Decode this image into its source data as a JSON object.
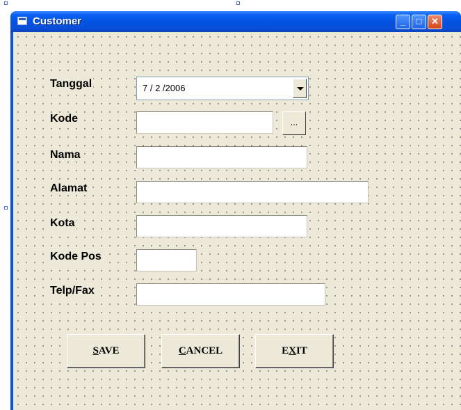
{
  "window": {
    "title": "Customer",
    "minimize_glyph": "_",
    "maximize_glyph": "□",
    "close_glyph": "✕"
  },
  "form": {
    "tanggal": {
      "label": "Tanggal",
      "value": "7 / 2 /2006"
    },
    "kode": {
      "label": "Kode",
      "value": "",
      "browse_label": "..."
    },
    "nama": {
      "label": "Nama",
      "value": ""
    },
    "alamat": {
      "label": "Alamat",
      "value": ""
    },
    "kota": {
      "label": "Kota",
      "value": ""
    },
    "kode_pos": {
      "label": "Kode Pos",
      "value": ""
    },
    "telp_fax": {
      "label": "Telp/Fax",
      "value": ""
    }
  },
  "buttons": {
    "save": {
      "accel": "S",
      "rest": "AVE"
    },
    "cancel": {
      "accel": "C",
      "rest": "ANCEL"
    },
    "exit": {
      "pre": "E",
      "accel": "X",
      "rest": "IT"
    }
  },
  "icons": [
    "window-icon",
    "minimize-icon",
    "maximize-icon",
    "close-icon",
    "dropdown-arrow-icon"
  ]
}
